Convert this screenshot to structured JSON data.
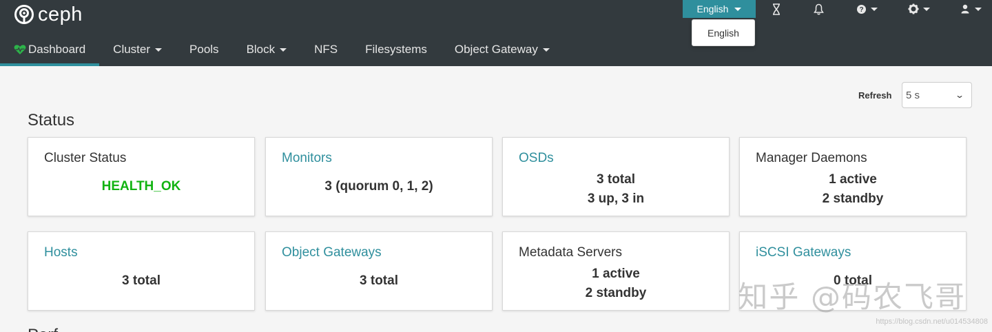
{
  "brand": {
    "name": "ceph"
  },
  "header": {
    "language_button": "English",
    "language_menu_item": "English",
    "icons": [
      "hourglass-icon",
      "bell-icon",
      "help-icon",
      "gear-icon",
      "user-icon"
    ]
  },
  "nav": {
    "dashboard": "Dashboard",
    "cluster": "Cluster",
    "pools": "Pools",
    "block": "Block",
    "nfs": "NFS",
    "filesystems": "Filesystems",
    "object_gateway": "Object Gateway"
  },
  "refresh": {
    "label": "Refresh",
    "value": "5 s"
  },
  "status": {
    "title": "Status",
    "cards": {
      "cluster_status": {
        "title": "Cluster Status",
        "line1": "HEALTH_OK"
      },
      "monitors": {
        "title": "Monitors",
        "line1": "3 (quorum 0, 1, 2)"
      },
      "osds": {
        "title": "OSDs",
        "line1": "3 total",
        "line2": "3 up, 3 in"
      },
      "managers": {
        "title": "Manager Daemons",
        "line1": "1 active",
        "line2": "2 standby"
      },
      "hosts": {
        "title": "Hosts",
        "line1": "3 total"
      },
      "object_gateways": {
        "title": "Object Gateways",
        "line1": "3 total"
      },
      "metadata_servers": {
        "title": "Metadata Servers",
        "line1": "1 active",
        "line2": "2 standby"
      },
      "iscsi_gateways": {
        "title": "iSCSI Gateways",
        "line1": "0 total"
      }
    }
  },
  "next_section": {
    "title": "Perf"
  },
  "watermark": {
    "text": "知乎 @码农飞哥",
    "url": "https://blog.csdn.net/u014534808"
  },
  "colors": {
    "header_bg": "#333a3e",
    "accent": "#2f8f9d",
    "health_ok": "#12b312",
    "page_bg": "#f5f5f5"
  }
}
